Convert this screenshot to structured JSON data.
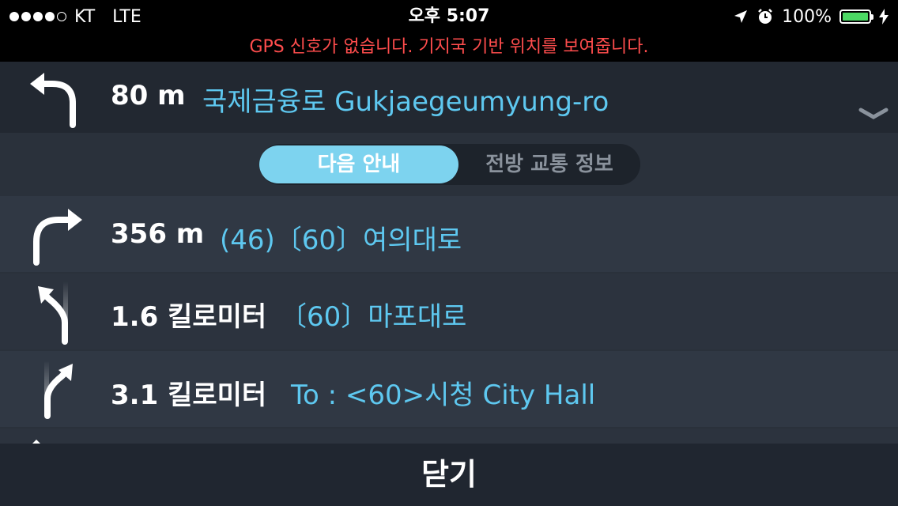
{
  "status_bar": {
    "carrier": "KT",
    "network": "LTE",
    "time": "오후 5:07",
    "battery_percent": "100%",
    "battery_level": 1.0,
    "battery_color": "#4cd964",
    "signal_bars": 4,
    "signal_max": 5
  },
  "gps_warning": "GPS 신호가 없습니다. 기지국 기반 위치를 보여줍니다.",
  "current": {
    "distance": "80 m",
    "road": "국제금융로 Gukjaegeumyung-ro",
    "icon": "turn-left-icon"
  },
  "segment": {
    "active_label": "다음 안내",
    "inactive_label": "전방 교통 정보"
  },
  "list": [
    {
      "distance": "356 m",
      "road": "(46)〔60〕여의대로",
      "icon": "turn-right-icon"
    },
    {
      "distance": "1.6 킬로미터",
      "road": "〔60〕마포대로",
      "icon": "keep-left-icon"
    },
    {
      "distance": "3.1 킬로미터",
      "road": "To : <60>시청 City Hall",
      "icon": "keep-right-icon"
    }
  ],
  "footer": {
    "close_label": "닫기"
  },
  "colors": {
    "accent": "#5ec8f0",
    "segment_active": "#7dd3ef",
    "warning": "#ff4d4d"
  }
}
